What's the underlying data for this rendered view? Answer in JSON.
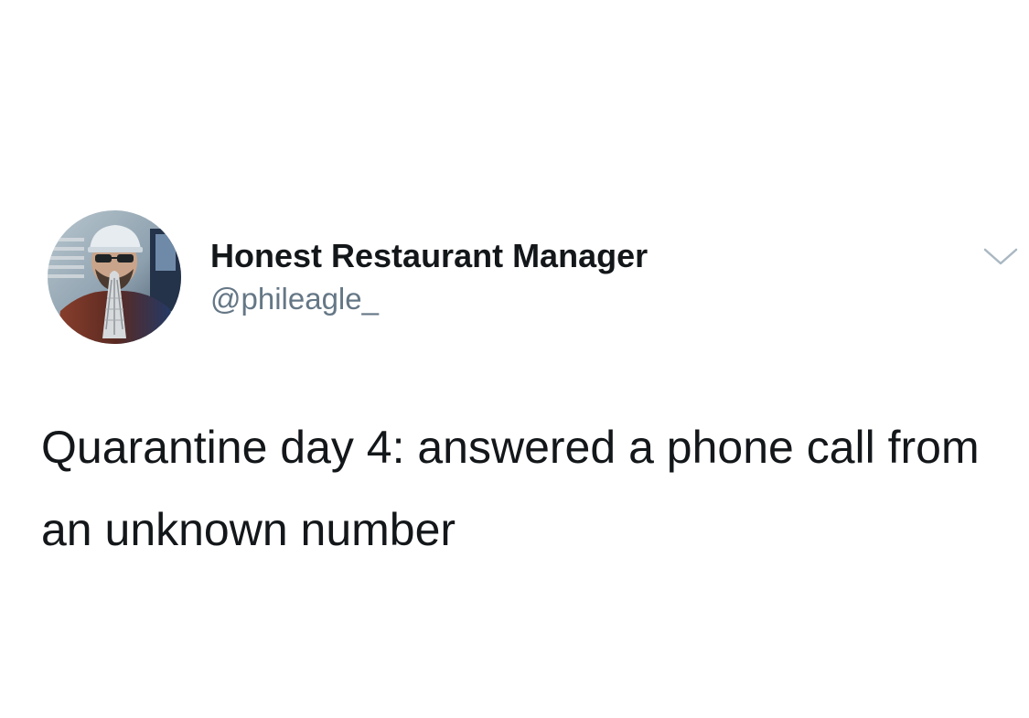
{
  "tweet": {
    "author": {
      "display_name": "Honest Restaurant Manager",
      "handle": "@phileagle_",
      "avatar_icon": "avatar-photo"
    },
    "menu_icon": "chevron-down-icon",
    "text": "Quarantine day 4: answered a phone call from an unknown number"
  },
  "colors": {
    "text_primary": "#14171a",
    "text_secondary": "#657786",
    "background": "#ffffff",
    "chevron": "#aab8c2"
  }
}
